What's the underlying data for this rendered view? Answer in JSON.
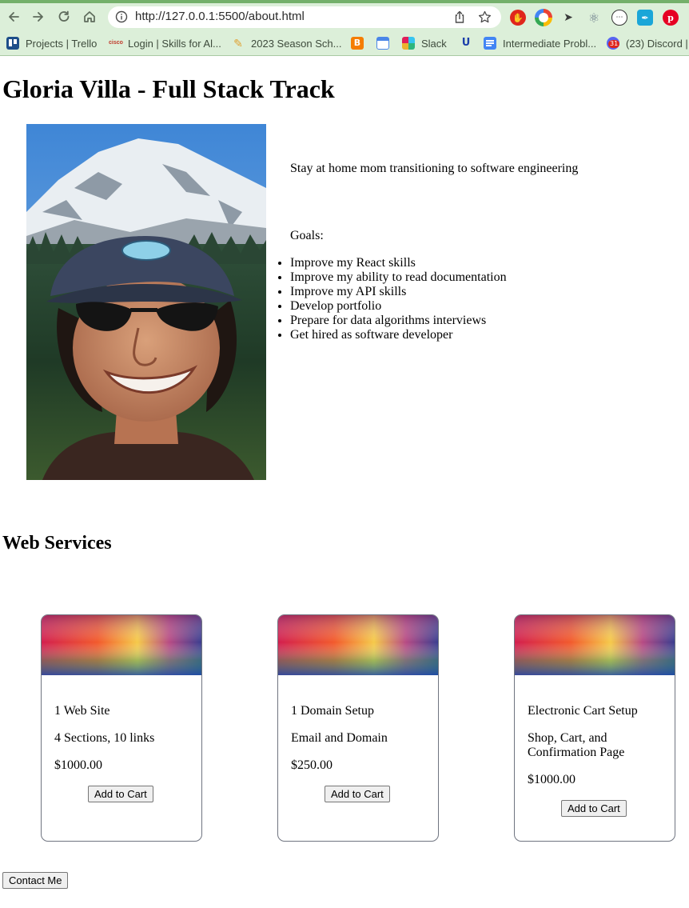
{
  "browser": {
    "url": "http://127.0.0.1:5500/about.html",
    "bookmarks": [
      {
        "label": "Projects | Trello",
        "icon": "trello-icon",
        "color": "#1d4e89"
      },
      {
        "label": "Login | Skills for Al...",
        "icon": "cisco-icon",
        "color": "#1ba0d7"
      },
      {
        "label": "2023 Season Sch...",
        "icon": "pencil-icon",
        "color": "#e0a030"
      },
      {
        "label": "",
        "icon": "blogger-icon",
        "color": "#f57d00"
      },
      {
        "label": "",
        "icon": "calendar-icon",
        "color": "#4a86e8"
      },
      {
        "label": "Slack",
        "icon": "slack-icon",
        "color": "#e01e5a"
      },
      {
        "label": "",
        "icon": "udacity-icon",
        "color": "#1c3faa"
      },
      {
        "label": "Intermediate Probl...",
        "icon": "docs-icon",
        "color": "#4285f4"
      },
      {
        "label": "(23) Discord |",
        "icon": "discord-icon",
        "color": "#5865f2"
      }
    ],
    "discord_badge": "31"
  },
  "page": {
    "title": "Gloria Villa - Full Stack Track",
    "tagline": "Stay at home mom transitioning to software engineering",
    "goals_label": "Goals:",
    "goals": [
      "Improve my React skills",
      "Improve my ability to read documentation",
      "Improve my API skills",
      "Develop portfolio",
      "Prepare for data algorithms interviews",
      "Get hired as software developer"
    ],
    "services_heading": "Web Services",
    "services": [
      {
        "name": "1 Web Site",
        "description": "4 Sections, 10 links",
        "price": "$1000.00",
        "button": "Add to Cart"
      },
      {
        "name": "1 Domain Setup",
        "description": "Email and Domain",
        "price": "$250.00",
        "button": "Add to Cart"
      },
      {
        "name": "Electronic Cart Setup",
        "description": "Shop, Cart, and Confirmation Page",
        "price": "$1000.00",
        "button": "Add to Cart"
      }
    ],
    "contact_button": "Contact Me"
  }
}
